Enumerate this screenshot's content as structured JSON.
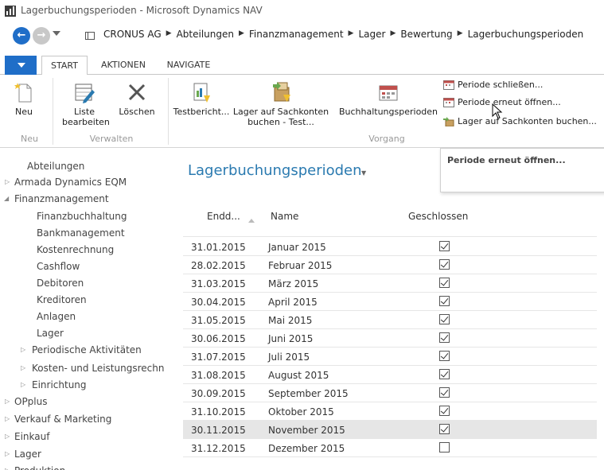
{
  "window": {
    "title": "Lagerbuchungsperioden - Microsoft Dynamics NAV"
  },
  "breadcrumb": [
    "CRONUS AG",
    "Abteilungen",
    "Finanzmanagement",
    "Lager",
    "Bewertung",
    "Lagerbuchungsperioden"
  ],
  "ribbon": {
    "tabs": [
      "START",
      "AKTIONEN",
      "NAVIGATE"
    ],
    "active_tab": "START",
    "buttons": {
      "neu": "Neu",
      "liste_bearbeiten": "Liste bearbeiten",
      "loeschen": "Löschen",
      "testbericht": "Testbericht...",
      "lager_sachkonten_test": "Lager auf Sachkonten buchen - Test...",
      "buchhaltungsperioden": "Buchhaltungsperioden",
      "periode_schliessen": "Periode schließen...",
      "periode_erneut_oeffnen": "Periode erneut öffnen...",
      "lager_sachkonten_buchen": "Lager auf Sachkonten buchen..."
    },
    "groups": {
      "neu": "Neu",
      "verwalten": "Verwalten",
      "vorgang": "Vorgang"
    }
  },
  "tooltip": {
    "text": "Periode erneut öffnen..."
  },
  "sidebar": {
    "items": [
      {
        "label": "Abteilungen"
      },
      {
        "label": "Armada Dynamics EQM"
      },
      {
        "label": "Finanzmanagement"
      },
      {
        "label": "Finanzbuchhaltung"
      },
      {
        "label": "Bankmanagement"
      },
      {
        "label": "Kostenrechnung"
      },
      {
        "label": "Cashflow"
      },
      {
        "label": "Debitoren"
      },
      {
        "label": "Kreditoren"
      },
      {
        "label": "Anlagen"
      },
      {
        "label": "Lager"
      },
      {
        "label": "Periodische Aktivitäten"
      },
      {
        "label": "Kosten- und Leistungsrechn"
      },
      {
        "label": "Einrichtung"
      },
      {
        "label": "OPplus"
      },
      {
        "label": "Verkauf & Marketing"
      },
      {
        "label": "Einkauf"
      },
      {
        "label": "Lager"
      },
      {
        "label": "Produktion"
      }
    ]
  },
  "main": {
    "title": "Lagerbuchungsperioden",
    "columns": {
      "date": "Endd...",
      "name": "Name",
      "closed": "Geschlossen"
    },
    "rows": [
      {
        "date": "31.01.2015",
        "name": "Januar 2015",
        "closed": true
      },
      {
        "date": "28.02.2015",
        "name": "Februar 2015",
        "closed": true
      },
      {
        "date": "31.03.2015",
        "name": "März 2015",
        "closed": true
      },
      {
        "date": "30.04.2015",
        "name": "April 2015",
        "closed": true
      },
      {
        "date": "31.05.2015",
        "name": "Mai 2015",
        "closed": true
      },
      {
        "date": "30.06.2015",
        "name": "Juni 2015",
        "closed": true
      },
      {
        "date": "31.07.2015",
        "name": "Juli 2015",
        "closed": true
      },
      {
        "date": "31.08.2015",
        "name": "August 2015",
        "closed": true
      },
      {
        "date": "30.09.2015",
        "name": "September 2015",
        "closed": true
      },
      {
        "date": "31.10.2015",
        "name": "Oktober 2015",
        "closed": true
      },
      {
        "date": "30.11.2015",
        "name": "November 2015",
        "closed": true,
        "selected": true
      },
      {
        "date": "31.12.2015",
        "name": "Dezember 2015",
        "closed": false
      }
    ]
  },
  "colors": {
    "accent": "#1f6ec8",
    "title": "#2a7ab0",
    "selected_row": "#e6e6e6"
  }
}
